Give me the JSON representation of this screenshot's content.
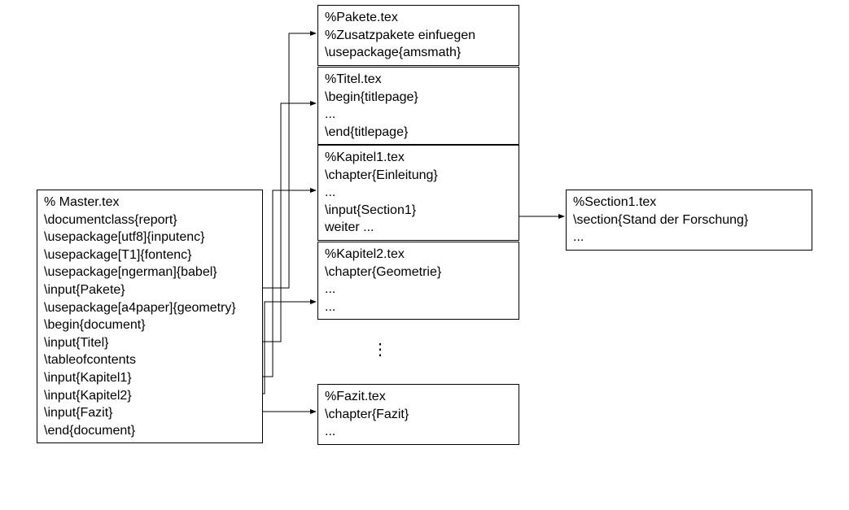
{
  "master": {
    "lines": [
      "% Master.tex",
      "\\documentclass{report}",
      "\\usepackage[utf8]{inputenc}",
      "\\usepackage[T1]{fontenc}",
      "\\usepackage[ngerman]{babel}",
      "\\input{Pakete}",
      "\\usepackage[a4paper]{geometry}",
      "\\begin{document}",
      "\\input{Titel}",
      "\\tableofcontents",
      "\\input{Kapitel1}",
      "\\input{Kapitel2}",
      "\\input{Fazit}",
      "\\end{document}"
    ]
  },
  "pakete": {
    "lines": [
      "%Pakete.tex",
      "%Zusatzpakete einfuegen",
      "\\usepackage{amsmath}"
    ]
  },
  "titel": {
    "lines": [
      "%Titel.tex",
      "\\begin{titlepage}",
      "...",
      "\\end{titlepage}"
    ]
  },
  "kapitel1": {
    "lines": [
      "%Kapitel1.tex",
      "\\chapter{Einleitung}",
      "...",
      "\\input{Section1}",
      "weiter ..."
    ]
  },
  "kapitel2": {
    "lines": [
      "%Kapitel2.tex",
      "\\chapter{Geometrie}",
      "...",
      "..."
    ]
  },
  "fazit": {
    "lines": [
      "%Fazit.tex",
      "\\chapter{Fazit}",
      "..."
    ]
  },
  "section1": {
    "lines": [
      "%Section1.tex",
      "\\section{Stand der Forschung}",
      "..."
    ]
  },
  "vdots": "⋮"
}
